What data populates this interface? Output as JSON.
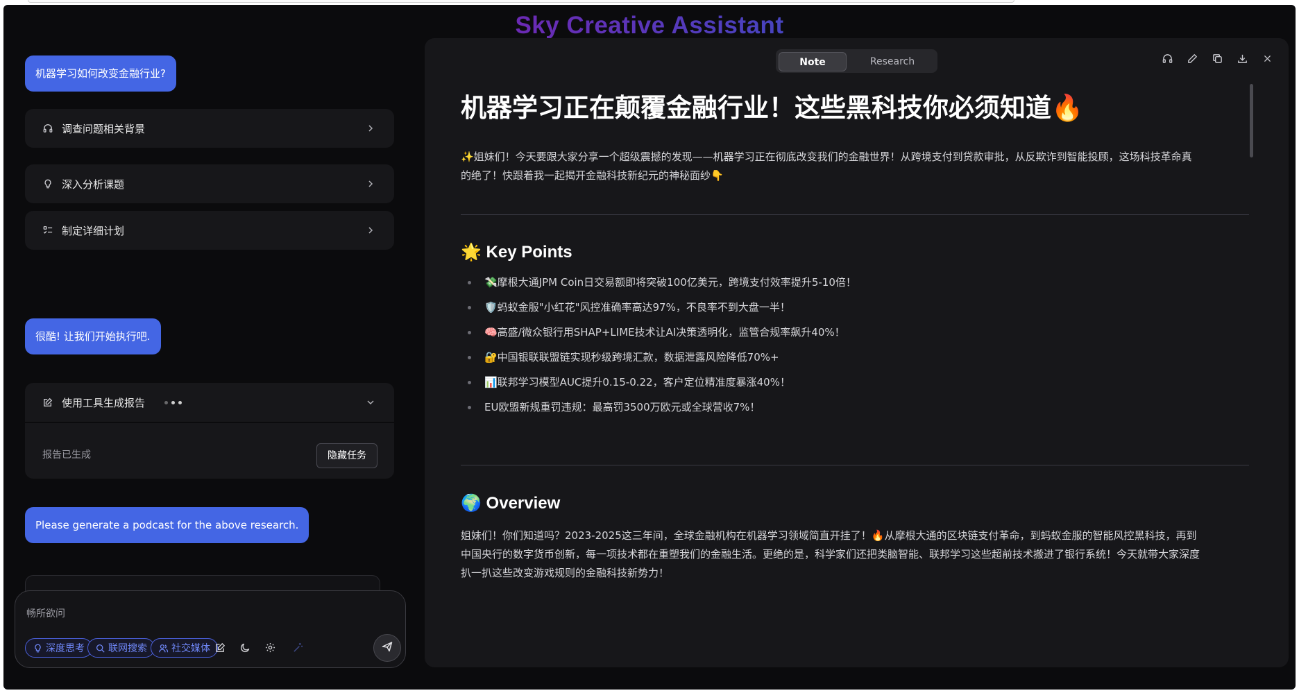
{
  "app": {
    "title": "Sky Creative Assistant"
  },
  "chat": {
    "user_message_1": "机器学习如何改变金融行业?",
    "steps": [
      {
        "label": "调查问题相关背景",
        "icon": "headphones-icon"
      },
      {
        "label": "深入分析课题",
        "icon": "lightbulb-icon"
      },
      {
        "label": "制定详细计划",
        "icon": "list-check-icon"
      }
    ],
    "user_message_2": "很酷! 让我们开始执行吧.",
    "tool_card": {
      "title": "使用工具生成报告",
      "status": "报告已生成",
      "hide_button": "隐藏任务"
    },
    "user_message_3": "Please generate a podcast for the above research."
  },
  "composer": {
    "placeholder": "畅所欲问",
    "chips": [
      {
        "label": "深度思考",
        "icon": "lightbulb-icon"
      },
      {
        "label": "联网搜索",
        "icon": "search-icon"
      },
      {
        "label": "社交媒体",
        "icon": "users-icon"
      }
    ]
  },
  "panel": {
    "tabs": [
      "Note",
      "Research"
    ],
    "active_tab": "Note",
    "title": "机器学习正在颠覆金融行业！这些黑科技你必须知道🔥",
    "intro_line1": "✨姐妹们！今天要跟大家分享一个超级震撼的发现——机器学习正在彻底改变我们的金融世界！从跨境支付到贷款审批，从反欺诈到智能投顾，这场科技革命真",
    "intro_line2": "的绝了！快跟着我一起揭开金融科技新纪元的神秘面纱👇",
    "key_points_heading": "🌟 Key Points",
    "key_points": [
      "💸摩根大通JPM Coin日交易额即将突破100亿美元，跨境支付效率提升5-10倍！",
      "🛡️蚂蚁金服\"小红花\"风控准确率高达97%，不良率不到大盘一半！",
      "🧠高盛/微众银行用SHAP+LIME技术让AI决策透明化，监管合规率飙升40%！",
      "🔐中国银联联盟链实现秒级跨境汇款，数据泄露风险降低70%+",
      "📊联邦学习模型AUC提升0.15-0.22，客户定位精准度暴涨40%！",
      "EU欧盟新规重罚违规：最高罚3500万欧元或全球营收7%！"
    ],
    "overview_heading": "🌍 Overview",
    "overview_line1": "姐妹们！你们知道吗？2023-2025这三年间，全球金融机构在机器学习领域简直开挂了！🔥从摩根大通的区块链支付革命，到蚂蚁金服的智能风控黑科技，再到",
    "overview_line2": "中国央行的数字货币创新，每一项技术都在重塑我们的金融生活。更绝的是，科学家们还把类脑智能、联邦学习这些超前技术搬进了银行系统！今天就带大家深度",
    "overview_line3": "扒一扒这些改变游戏规则的金融科技新势力！"
  }
}
